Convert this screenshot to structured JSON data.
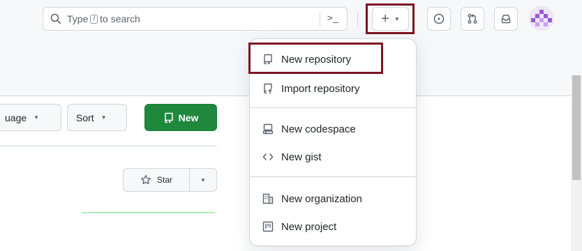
{
  "header": {
    "search": {
      "prefix": "Type",
      "shortcut_key": "/",
      "suffix": "to search",
      "command_palette_icon": "terminal-icon"
    },
    "create_button": {
      "icon": "plus-icon",
      "caret_icon": "triangle-down-icon"
    },
    "issues_icon": "issue-opened-icon",
    "pull_requests_icon": "git-pull-request-icon",
    "inbox_icon": "inbox-icon",
    "avatar_icon": "identicon-avatar"
  },
  "create_menu": {
    "items": [
      {
        "label": "New repository",
        "icon": "repo-icon"
      },
      {
        "label": "Import repository",
        "icon": "repo-push-icon"
      },
      {
        "label": "New codespace",
        "icon": "codespaces-icon"
      },
      {
        "label": "New gist",
        "icon": "code-icon"
      },
      {
        "label": "New organization",
        "icon": "organization-icon"
      },
      {
        "label": "New project",
        "icon": "project-icon"
      }
    ]
  },
  "repo_toolbar": {
    "language_label": "uage",
    "sort_label": "Sort",
    "new_label": "New"
  },
  "repo_card": {
    "star_label": "Star"
  },
  "colors": {
    "new_button_bg": "#1f883d",
    "highlight_border": "#7d1322",
    "activity_line": "#aceebb"
  }
}
